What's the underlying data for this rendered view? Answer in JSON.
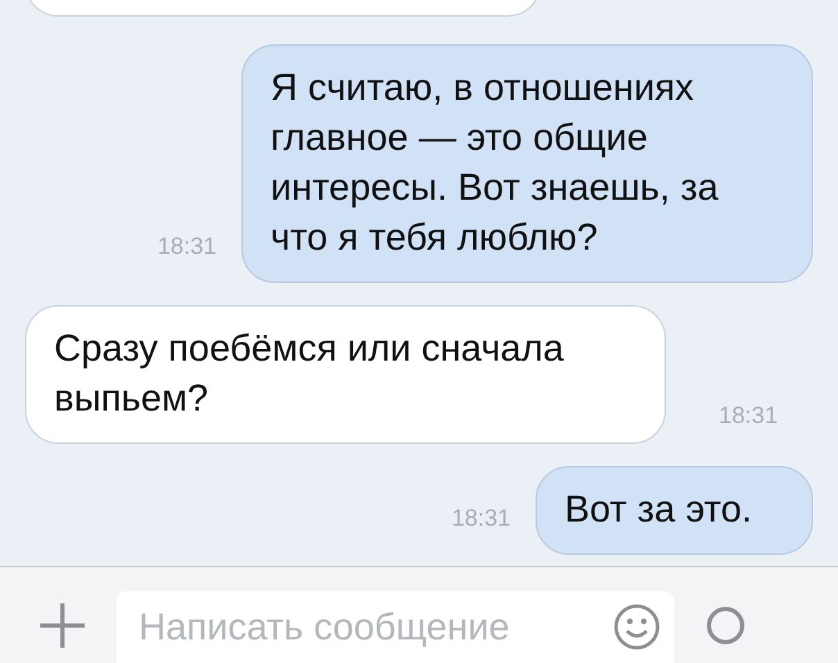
{
  "earlier_message": {
    "kind": "incoming"
  },
  "messages": [
    {
      "kind": "outgoing",
      "text": "Я считаю, в отношениях главное — это общие интересы. Вот знаешь, за что я тебя люблю?",
      "time": "18:31"
    },
    {
      "kind": "incoming",
      "text": "Сразу поебёмся или сначала выпьем?",
      "time": "18:31"
    },
    {
      "kind": "outgoing",
      "text": "Вот за это.",
      "time": "18:31"
    }
  ],
  "composer": {
    "placeholder": "Написать сообщение"
  }
}
